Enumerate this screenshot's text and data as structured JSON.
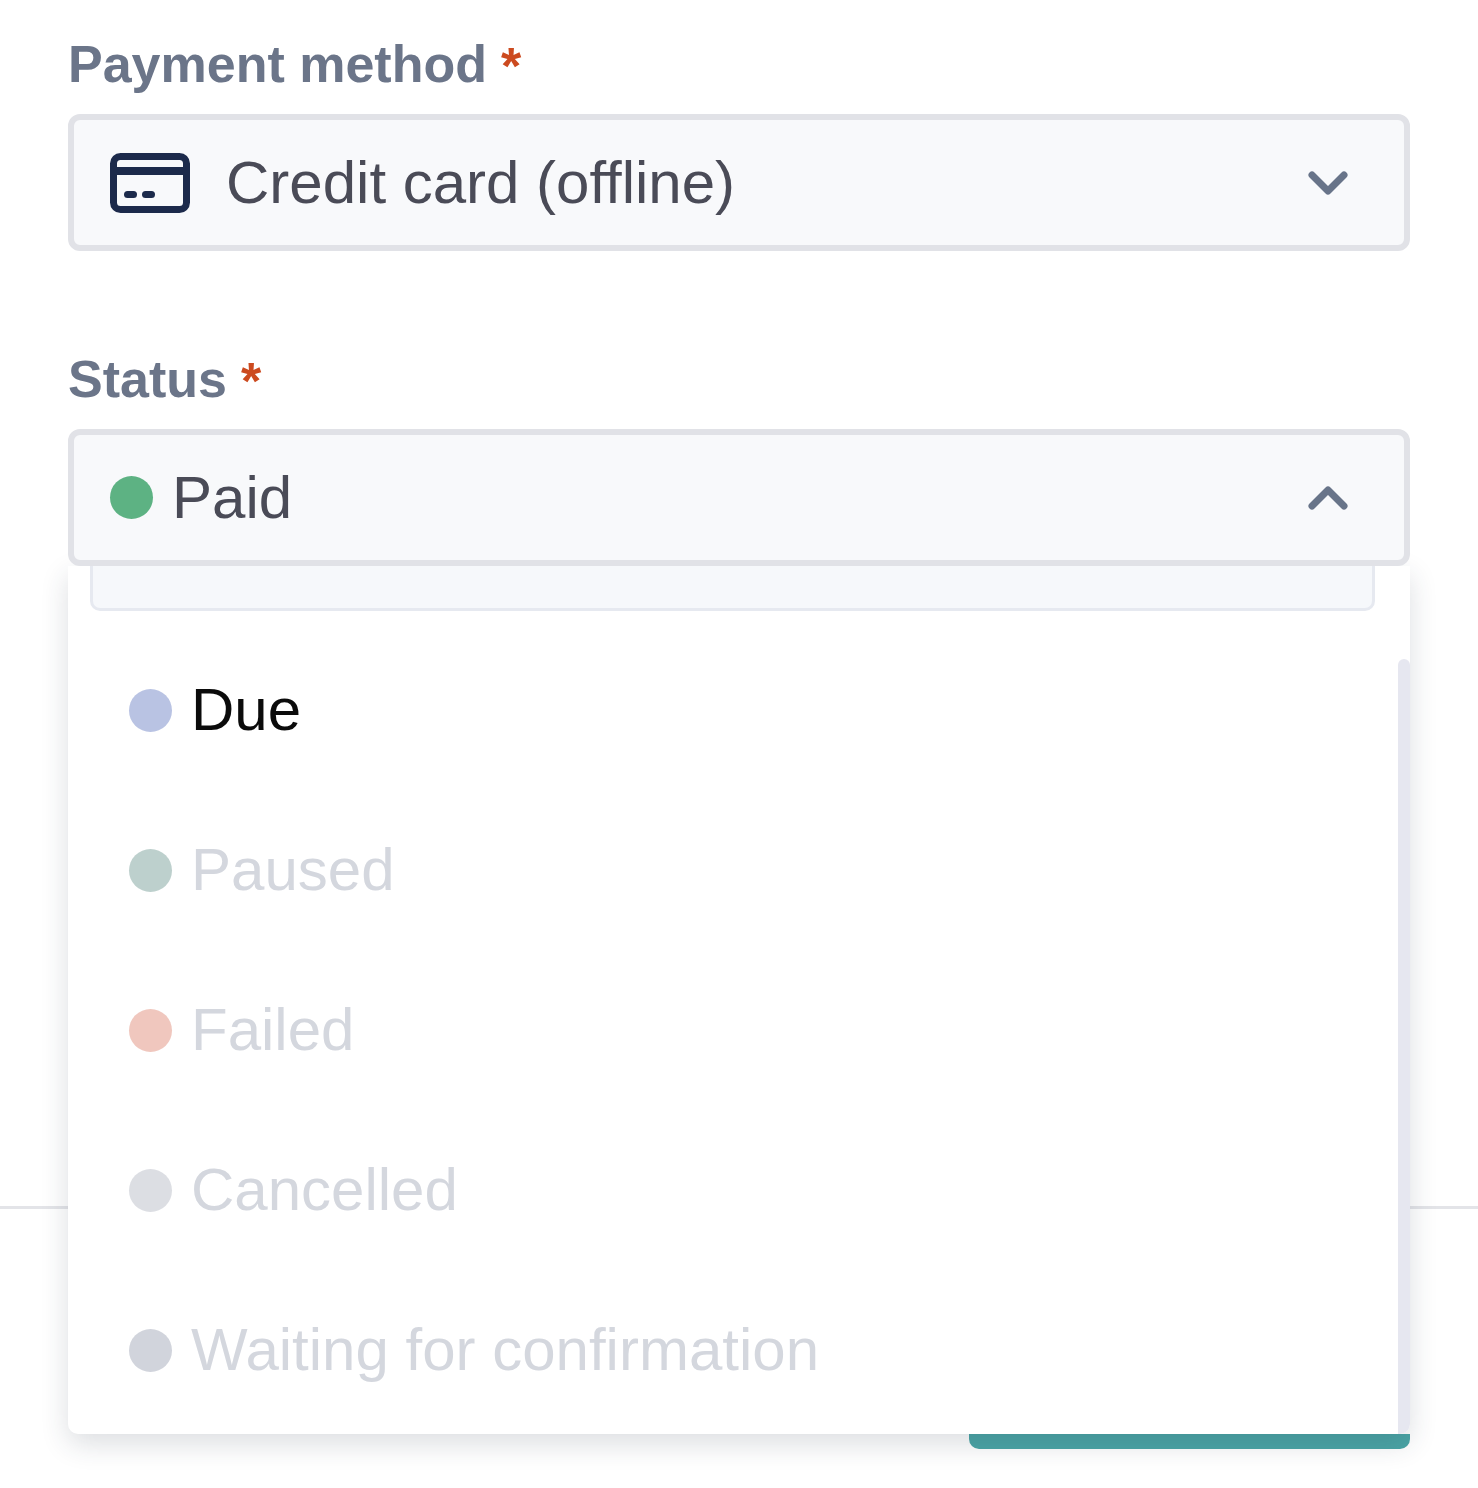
{
  "fields": [
    {
      "kind": "card",
      "label": "Payment method",
      "required_mark": "*",
      "value": "Credit card (offline)",
      "expanded": false
    },
    {
      "kind": "status",
      "label": "Status",
      "required_mark": "*",
      "value": "Paid",
      "color": "#5db283",
      "expanded": true
    }
  ],
  "status_options": [
    {
      "kind": "scrolled_remainder",
      "selected": true
    },
    {
      "kind": "option",
      "label": "Due",
      "color": "#b9c3e3",
      "disabled": false,
      "selected": false
    },
    {
      "kind": "option",
      "label": "Paused",
      "color": "#bdd0cd",
      "disabled": true,
      "selected": false
    },
    {
      "kind": "option",
      "label": "Failed",
      "color": "#f0c7be",
      "disabled": true,
      "selected": false
    },
    {
      "kind": "option",
      "label": "Cancelled",
      "color": "#dcdee3",
      "disabled": true,
      "selected": false
    },
    {
      "kind": "option",
      "label": "Waiting for confirmation",
      "color": "#d1d4dc",
      "disabled": true,
      "selected": false
    }
  ]
}
